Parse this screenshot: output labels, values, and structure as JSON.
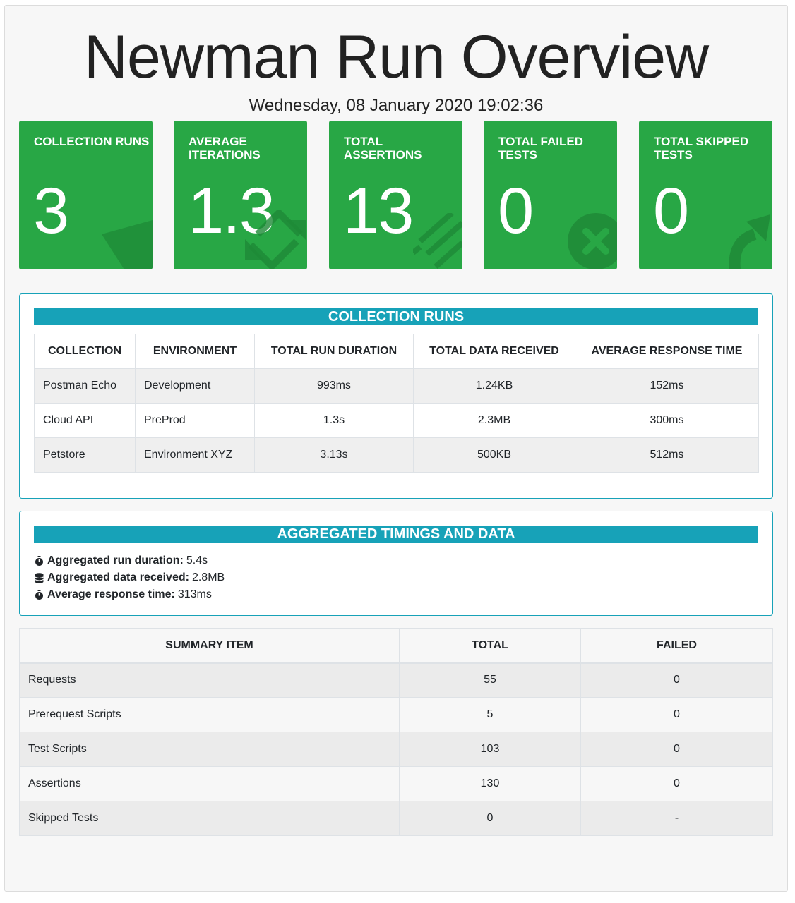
{
  "header": {
    "title": "Newman Run Overview",
    "date": "Wednesday, 08 January 2020 19:02:36"
  },
  "cards": [
    {
      "label": "COLLECTION RUNS",
      "value": "3",
      "icon": "paper-plane-icon"
    },
    {
      "label": "AVERAGE ITERATIONS",
      "value": "1.3",
      "icon": "sync-arrows-icon"
    },
    {
      "label": "TOTAL ASSERTIONS",
      "value": "13",
      "icon": "tasks-list-icon"
    },
    {
      "label": "TOTAL FAILED TESTS",
      "value": "0",
      "icon": "times-circle-icon"
    },
    {
      "label": "TOTAL SKIPPED TESTS",
      "value": "0",
      "icon": "share-arrow-icon"
    }
  ],
  "collection_runs": {
    "title": "COLLECTION RUNS",
    "columns": [
      "COLLECTION",
      "ENVIRONMENT",
      "TOTAL RUN DURATION",
      "TOTAL DATA RECEIVED",
      "AVERAGE RESPONSE TIME"
    ],
    "rows": [
      [
        "Postman Echo",
        "Development",
        "993ms",
        "1.24KB",
        "152ms"
      ],
      [
        "Cloud API",
        "PreProd",
        "1.3s",
        "2.3MB",
        "300ms"
      ],
      [
        "Petstore",
        "Environment XYZ",
        "3.13s",
        "500KB",
        "512ms"
      ]
    ]
  },
  "aggregated": {
    "title": "AGGREGATED TIMINGS AND DATA",
    "items": [
      {
        "icon": "stopwatch-icon",
        "label": "Aggregated run duration:",
        "value": "5.4s"
      },
      {
        "icon": "database-icon",
        "label": "Aggregated data received:",
        "value": "2.8MB"
      },
      {
        "icon": "stopwatch-icon",
        "label": "Average response time:",
        "value": "313ms"
      }
    ]
  },
  "summary": {
    "columns": [
      "SUMMARY ITEM",
      "TOTAL",
      "FAILED"
    ],
    "rows": [
      [
        "Requests",
        "55",
        "0"
      ],
      [
        "Prerequest Scripts",
        "5",
        "0"
      ],
      [
        "Test Scripts",
        "103",
        "0"
      ],
      [
        "Assertions",
        "130",
        "0"
      ],
      [
        "Skipped Tests",
        "0",
        "-"
      ]
    ]
  },
  "colors": {
    "card_green": "#28a745",
    "panel_teal": "#17a2b8"
  }
}
